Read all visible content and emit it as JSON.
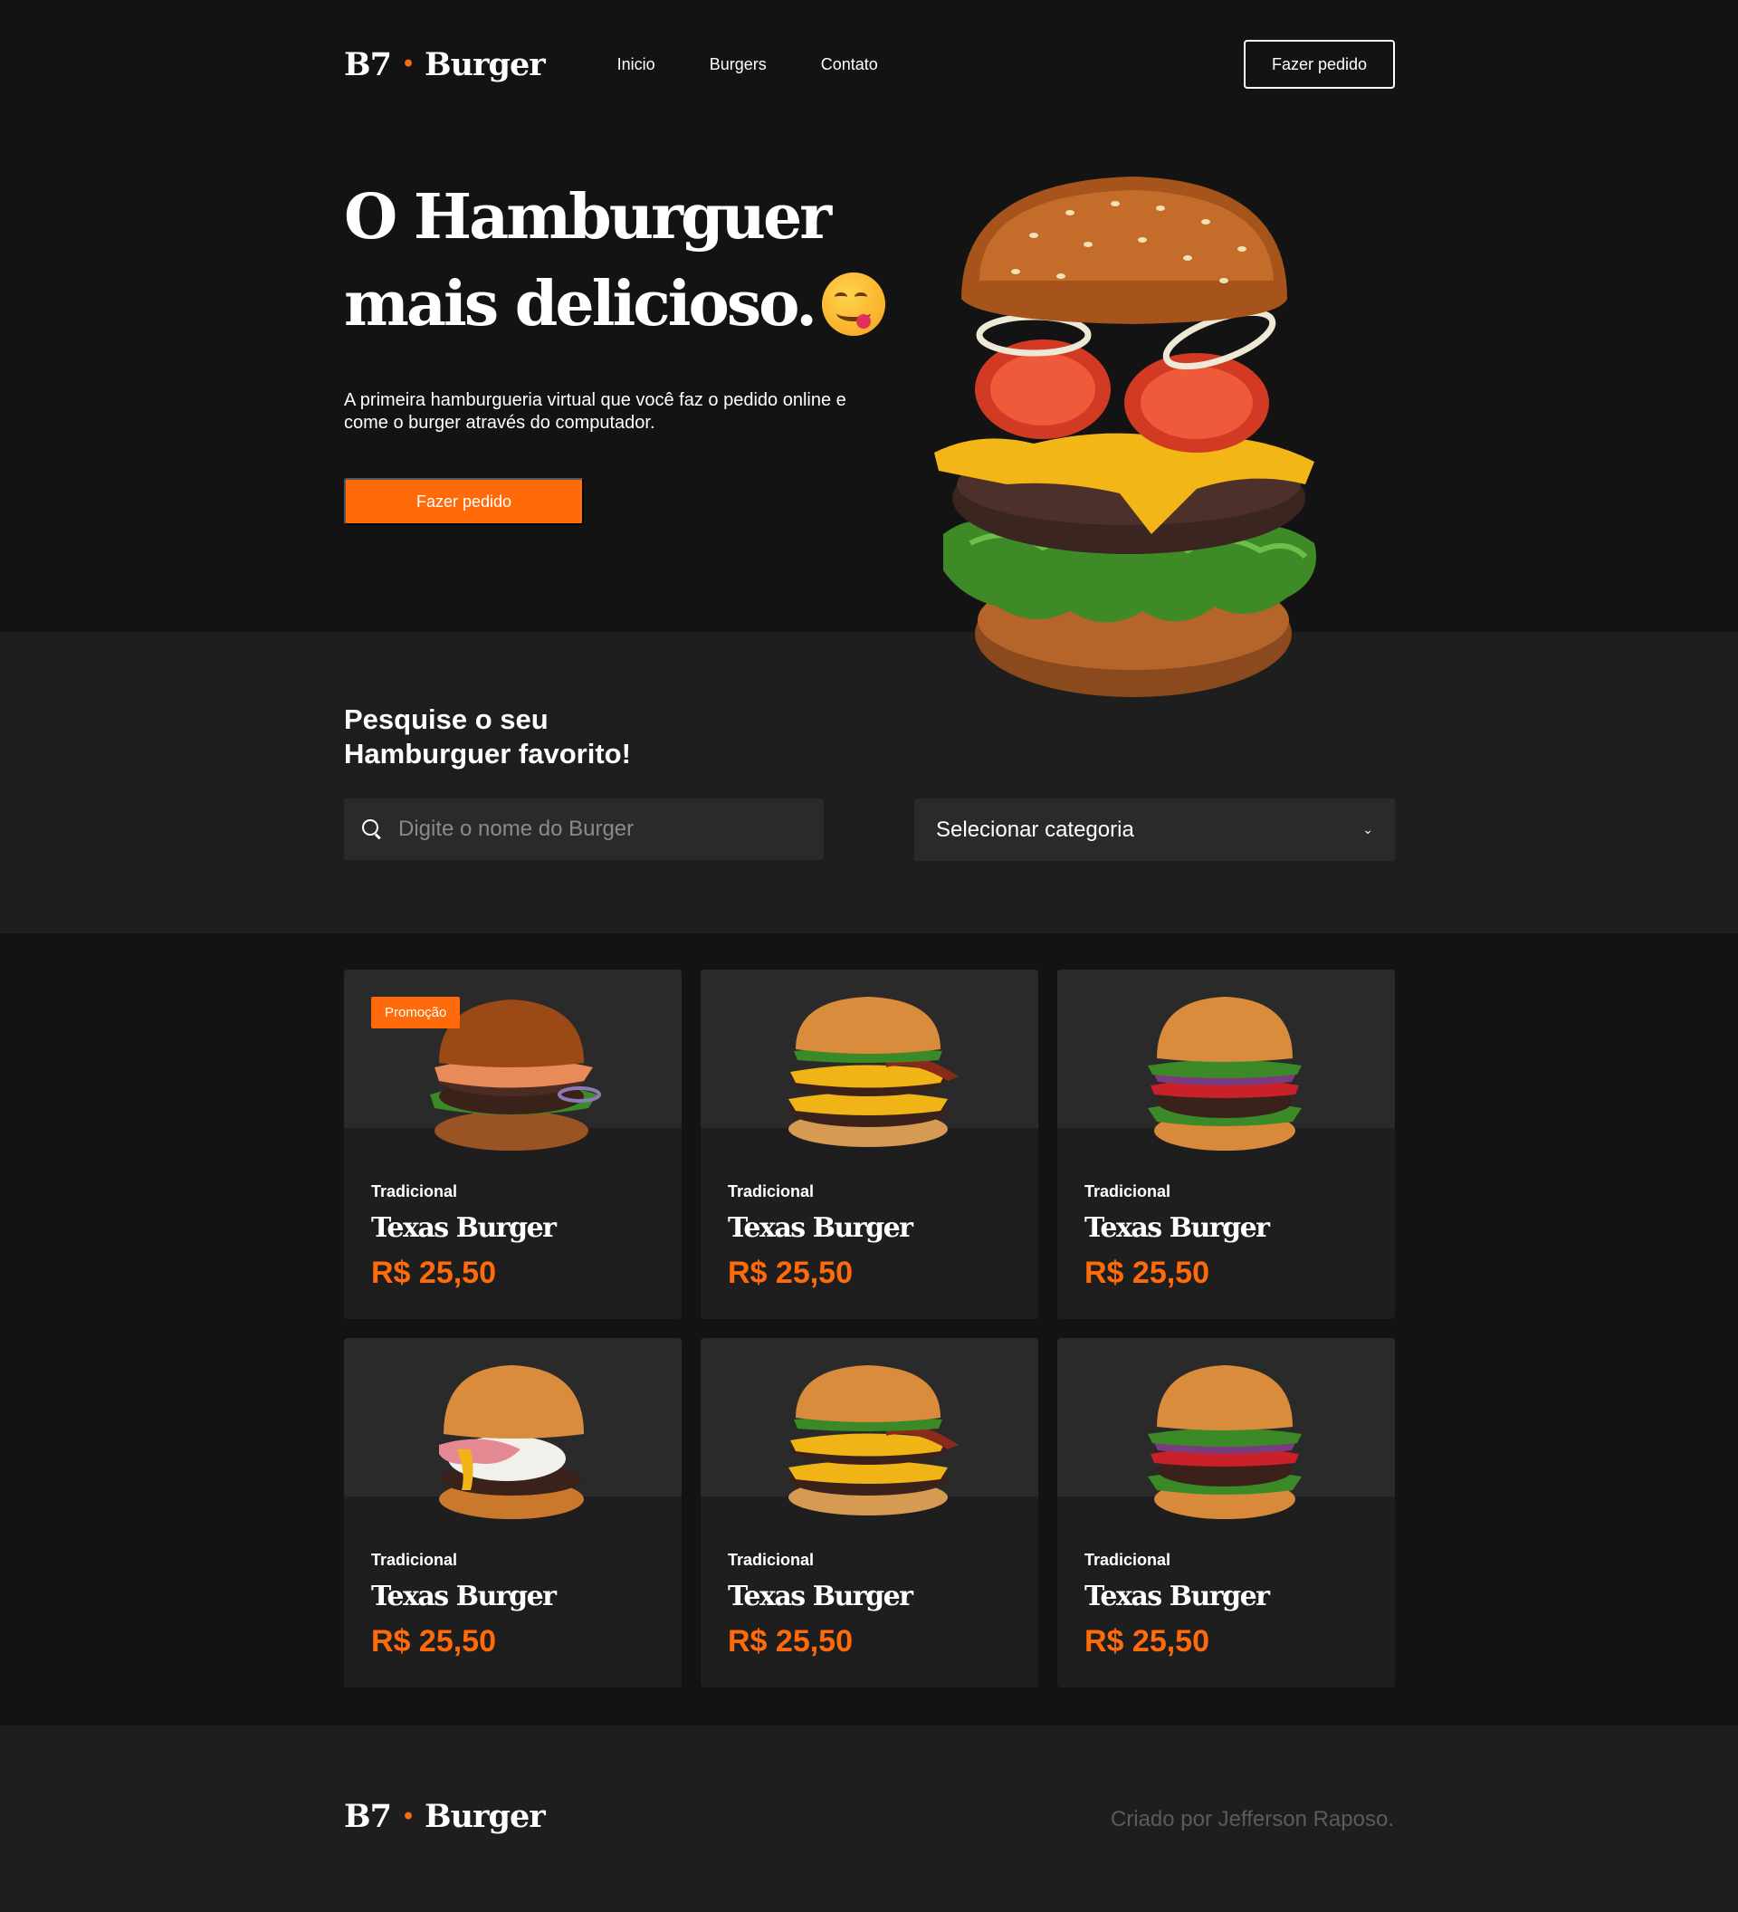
{
  "brand": {
    "left": "B7",
    "dot": "•",
    "right": "Burger"
  },
  "nav": {
    "items": [
      "Inicio",
      "Burgers",
      "Contato"
    ],
    "order_button": "Fazer pedido"
  },
  "hero": {
    "title_line1": "O Hamburguer",
    "title_line2": "mais delicioso.",
    "subtitle": "A primeira hamburgueria virtual que você faz o pedido online e come o burger através do computador.",
    "cta": "Fazer pedido"
  },
  "search": {
    "title_line1": "Pesquise o seu",
    "title_line2": "Hamburguer favorito!",
    "placeholder": "Digite o nome do Burger",
    "category_label": "Selecionar categoria"
  },
  "products": [
    {
      "badge": "Promoção",
      "category": "Tradicional",
      "name": "Texas Burger",
      "price": "R$ 25,50"
    },
    {
      "badge": "",
      "category": "Tradicional",
      "name": "Texas Burger",
      "price": "R$ 25,50"
    },
    {
      "badge": "",
      "category": "Tradicional",
      "name": "Texas Burger",
      "price": "R$ 25,50"
    },
    {
      "badge": "",
      "category": "Tradicional",
      "name": "Texas Burger",
      "price": "R$ 25,50"
    },
    {
      "badge": "",
      "category": "Tradicional",
      "name": "Texas Burger",
      "price": "R$ 25,50"
    },
    {
      "badge": "",
      "category": "Tradicional",
      "name": "Texas Burger",
      "price": "R$ 25,50"
    }
  ],
  "footer": {
    "credit": "Criado por Jefferson Raposo."
  },
  "colors": {
    "accent": "#ff6b0b",
    "background": "#131313",
    "panel": "#1e1e1e",
    "card_top": "#2a2a2a"
  }
}
